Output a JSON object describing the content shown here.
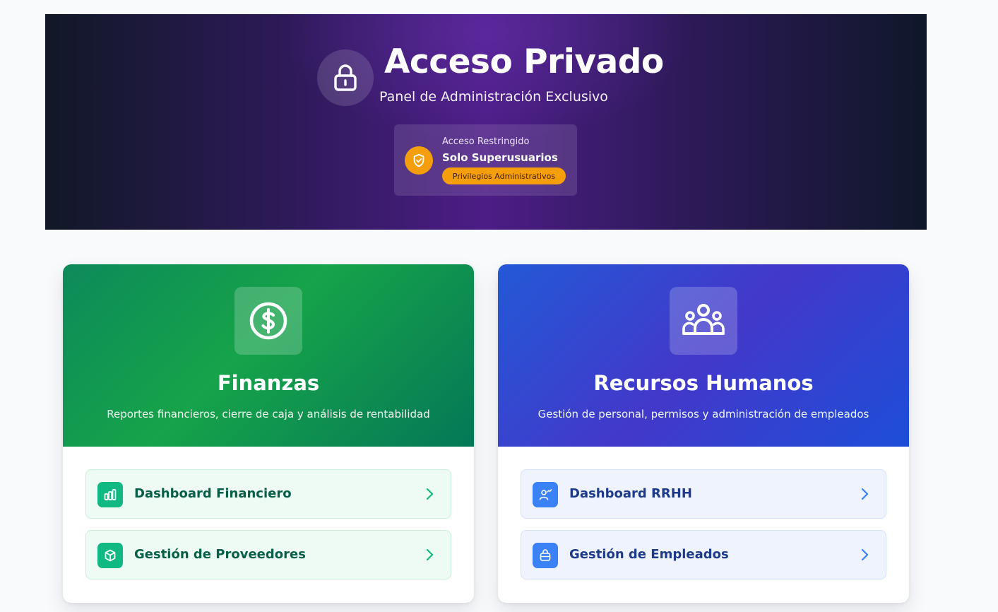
{
  "hero": {
    "title": "Acceso Privado",
    "subtitle": "Panel de Administración Exclusivo",
    "icon": "lock-icon",
    "badge": {
      "icon": "shield-check-icon",
      "label": "Acceso Restringido",
      "title": "Solo Superusuarios",
      "pill": "Privilegios Administrativos"
    }
  },
  "cards": [
    {
      "title": "Finanzas",
      "description": "Reportes financieros, cierre de caja y análisis de rentabilidad",
      "icon": "dollar-icon",
      "accent": "#16a34a",
      "items": [
        {
          "label": "Dashboard Financiero",
          "icon": "bar-chart-icon"
        },
        {
          "label": "Gestión de Proveedores",
          "icon": "box-icon"
        }
      ]
    },
    {
      "title": "Recursos Humanos",
      "description": "Gestión de personal, permisos y administración de empleados",
      "icon": "users-icon",
      "accent": "#4338ca",
      "items": [
        {
          "label": "Dashboard RRHH",
          "icon": "user-chart-icon"
        },
        {
          "label": "Gestión de Empleados",
          "icon": "briefcase-icon"
        }
      ]
    }
  ],
  "colors": {
    "hero_bg": "#2e1a5a",
    "badge_accent": "#f59e0b",
    "finance_item_icon": "#10b981",
    "hr_item_icon": "#3b82f6"
  }
}
